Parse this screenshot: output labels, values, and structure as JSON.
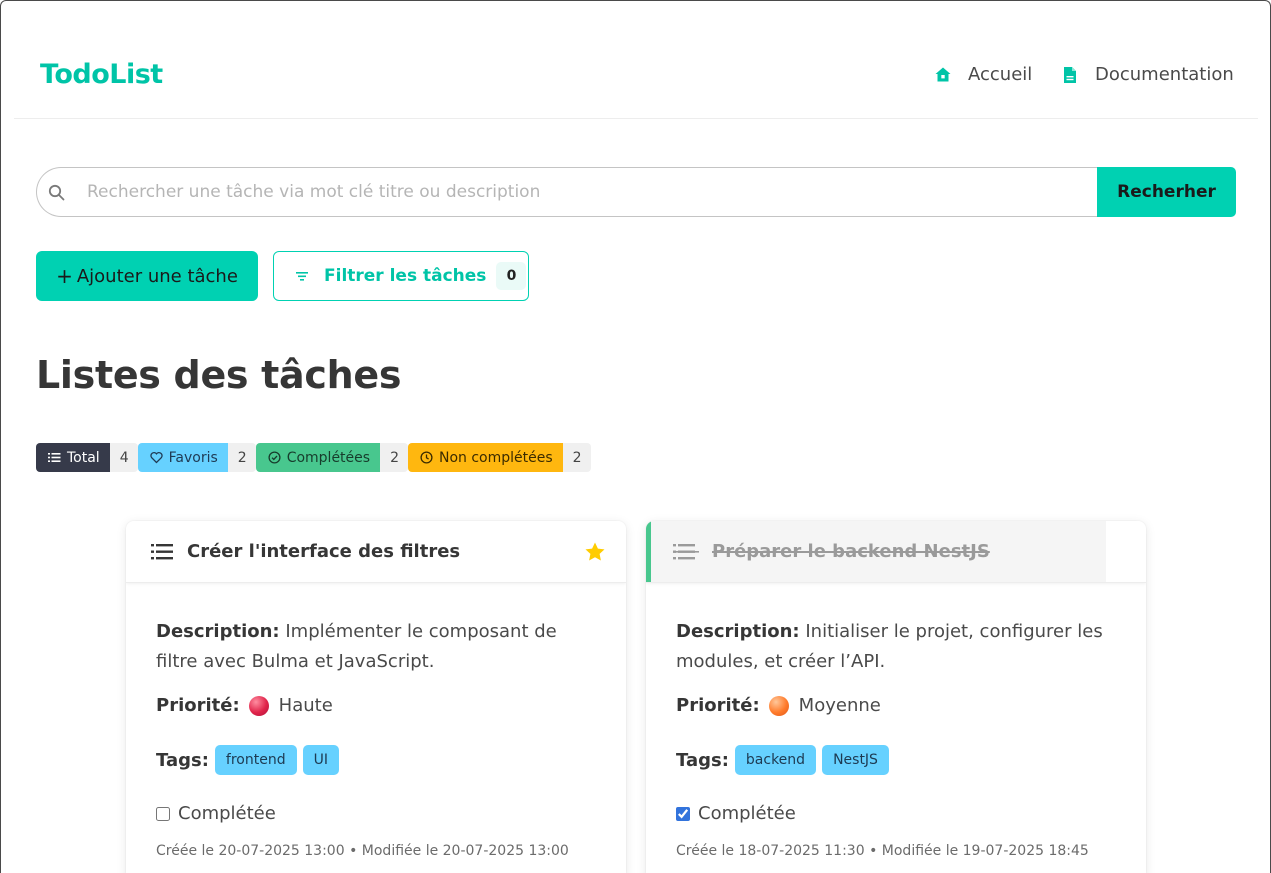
{
  "brand": "TodoList",
  "nav": {
    "home": "Accueil",
    "docs": "Documentation"
  },
  "search": {
    "placeholder": "Rechercher une tâche via mot clé titre ou description",
    "value": "",
    "button": "Recherher"
  },
  "actions": {
    "add": "Ajouter une tâche",
    "filter": "Filtrer les tâches",
    "filter_count": "0"
  },
  "page_title": "Listes des tâches",
  "stats": {
    "total": {
      "label": "Total",
      "count": "4"
    },
    "favorites": {
      "label": "Favoris",
      "count": "2"
    },
    "completed": {
      "label": "Complétées",
      "count": "2"
    },
    "not_completed": {
      "label": "Non complétées",
      "count": "2"
    }
  },
  "tasks": [
    {
      "title": "Créer l'interface des filtres",
      "favorite": true,
      "completed": false,
      "description_label": "Description:",
      "description": "Implémenter le composant de filtre avec Bulma et JavaScript.",
      "priority_label": "Priorité:",
      "priority": "Haute",
      "tags_label": "Tags:",
      "tags": [
        "frontend",
        "UI"
      ],
      "completed_label": "Complétée",
      "meta": "Créée le 20-07-2025 13:00 • Modifiée le 20-07-2025 13:00"
    },
    {
      "title": "Préparer le backend NestJS",
      "favorite": false,
      "completed": true,
      "description_label": "Description:",
      "description": "Initialiser le projet, configurer les modules, et créer l’API.",
      "priority_label": "Priorité:",
      "priority": "Moyenne",
      "tags_label": "Tags:",
      "tags": [
        "backend",
        "NestJS"
      ],
      "completed_label": "Complétée",
      "meta": "Créée le 18-07-2025 11:30 • Modifiée le 19-07-2025 18:45"
    }
  ],
  "colors": {
    "primary": "#00d1b2",
    "dark": "#363a4a",
    "info": "#66d1ff",
    "success": "#48c78e",
    "warning": "#ffb70f",
    "star": "#ffcc00"
  },
  "icons": {
    "home": "home-icon",
    "docs": "document-icon",
    "search": "search-icon",
    "filter": "filter-icon",
    "list": "list-icon",
    "heart": "heart-icon",
    "check": "check-circle-icon",
    "clock": "clock-icon",
    "star": "star-icon"
  }
}
